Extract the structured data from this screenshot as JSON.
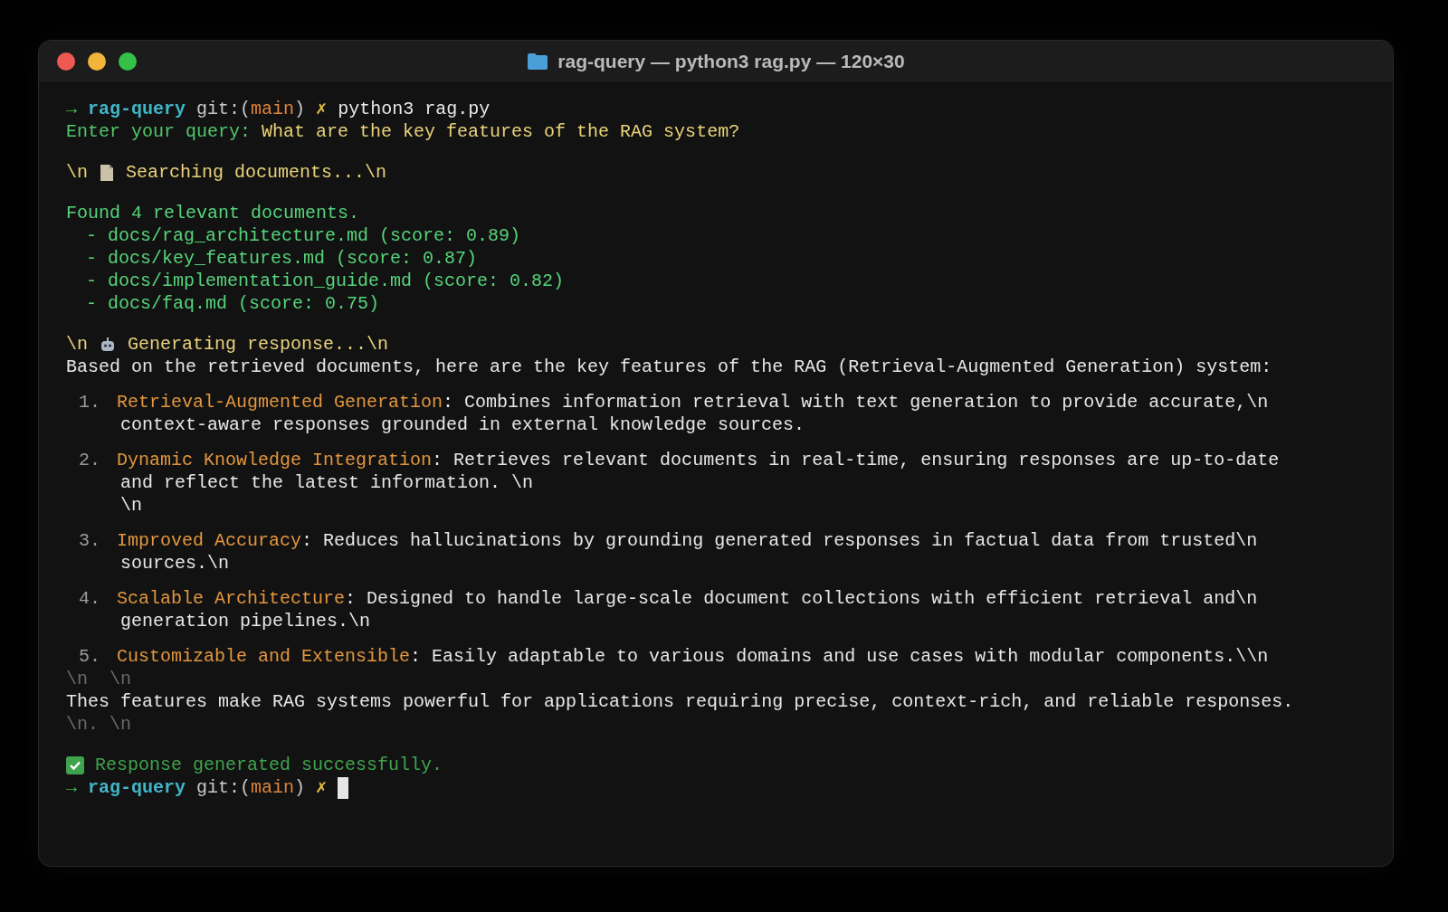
{
  "window": {
    "title": "rag-query — python3 rag.py — 120×30"
  },
  "terminal": {
    "command_line": {
      "arrow": "→",
      "directory": "rag-query",
      "git_open": "git:(",
      "branch": "main",
      "git_close": ")",
      "dirty": "✗",
      "command": "python3 rag.py"
    },
    "query": {
      "label": "Enter your query:",
      "text": "What are the key features of the RAG system?"
    },
    "searching": {
      "escape": "\\n",
      "text": "Searching documents...\\n"
    },
    "found": {
      "summary": "Found 4 relevant documents.",
      "documents": [
        "- docs/rag_architecture.md (score: 0.89)",
        "- docs/key_features.md (score: 0.87)",
        "- docs/implementation_guide.md (score: 0.82)",
        "- docs/faq.md (score: 0.75)"
      ]
    },
    "generating": {
      "escape": "\\n",
      "text": "Generating response...\\n"
    },
    "intro": "Based on the retrieved documents, here are the key features of the RAG (Retrieval-Augmented Generation) system:",
    "features": [
      {
        "number": "1.",
        "title": "Retrieval-Augmented Generation",
        "text": ": Combines information retrieval with text generation to provide accurate,\\n",
        "continuation": [
          "context-aware responses grounded in external knowledge sources."
        ]
      },
      {
        "number": "2.",
        "title": "Dynamic Knowledge Integration",
        "text": ": Retrieves relevant documents in real-time, ensuring responses are up-to-date",
        "continuation": [
          "and reflect the latest information. \\n",
          "\\n"
        ]
      },
      {
        "number": "3.",
        "title": "Improved Accuracy",
        "text": ": Reduces hallucinations by grounding generated responses in factual data from trusted\\n",
        "continuation": [
          "sources.\\n"
        ]
      },
      {
        "number": "4.",
        "title": "Scalable Architecture",
        "text": ": Designed to handle large-scale document collections with efficient retrieval and\\n",
        "continuation": [
          "generation pipelines.\\n"
        ]
      },
      {
        "number": "5.",
        "title": "Customizable and Extensible",
        "text": ": Easily adaptable to various domains and use cases with modular components.\\\\n"
      }
    ],
    "after_features": "\\n  \\n",
    "conclusion": "Thes features make RAG systems powerful for applications requiring precise, context-rich, and reliable responses.",
    "after_conclusion": "\\n. \\n",
    "success": "Response generated successfully.",
    "prompt": {
      "arrow": "→",
      "directory": "rag-query",
      "git_open": "git:(",
      "branch": "main",
      "git_close": ")",
      "dirty": "✗"
    }
  }
}
